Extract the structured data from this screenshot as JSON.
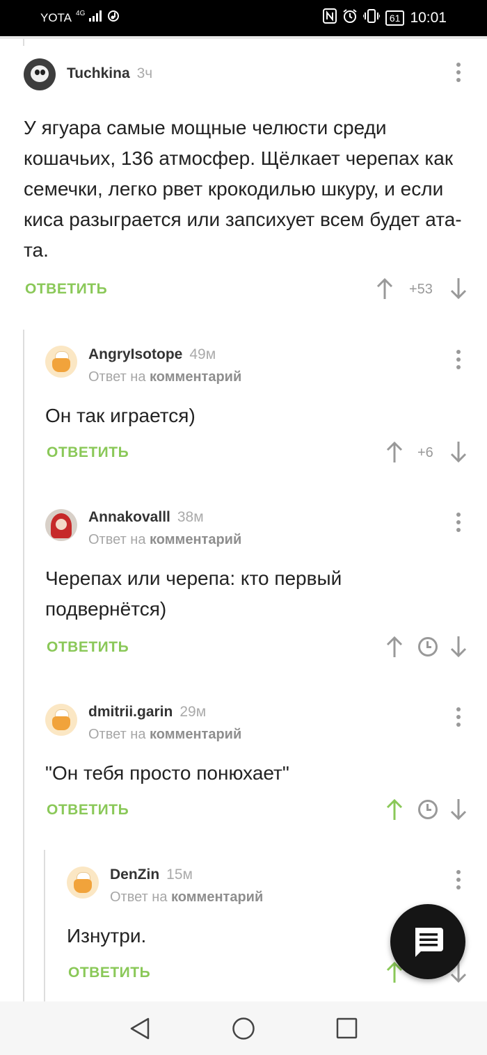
{
  "status_bar": {
    "carrier": "YOTA",
    "network": "4G",
    "battery": "61",
    "time": "10:01"
  },
  "comments": [
    {
      "username": "Tuchkina",
      "time": "3ч",
      "avatar": "panda-avatar",
      "text": "У ягуара самые мощные челюсти среди кошачьих, 136 атмосфер. Щёлкает черепах как семечки, легко рвет крокодилью шкуру, и если киса разыграется или запсихует всем будет ата-та.",
      "reply_label": "ОТВЕТИТЬ",
      "rating": "+53"
    },
    {
      "username": "AngryIsotope",
      "time": "49м",
      "avatar": "cook-avatar",
      "reply_prefix": "Ответ на",
      "reply_target": "комментарий",
      "text": "Он так играется)",
      "reply_label": "ОТВЕТИТЬ",
      "rating": "+6"
    },
    {
      "username": "Annakovalll",
      "time": "38м",
      "avatar": "red-riding-hood-avatar",
      "reply_prefix": "Ответ на",
      "reply_target": "комментарий",
      "text": "Черепах или черепа: кто первый подвернётся)",
      "reply_label": "ОТВЕТИТЬ",
      "rating_icon": "clock-icon"
    },
    {
      "username": "dmitrii.garin",
      "time": "29м",
      "avatar": "cook-avatar",
      "reply_prefix": "Ответ на",
      "reply_target": "комментарий",
      "text": "\"Он тебя просто понюхает\"",
      "reply_label": "ОТВЕТИТЬ",
      "rating_icon": "clock-icon",
      "upvoted": true
    },
    {
      "username": "DenZin",
      "time": "15м",
      "avatar": "cook-avatar",
      "reply_prefix": "Ответ на",
      "reply_target": "комментарий",
      "text": "Изнутри.",
      "reply_label": "ОТВЕТИТЬ",
      "upvoted": true
    }
  ],
  "colors": {
    "accent_green": "#8ac858",
    "text": "#222222",
    "muted": "#999999",
    "fab_background": "#151515"
  },
  "fab": {
    "icon": "comment-icon"
  },
  "navigation": {
    "icons": [
      "back-icon",
      "home-icon",
      "recents-icon"
    ]
  }
}
